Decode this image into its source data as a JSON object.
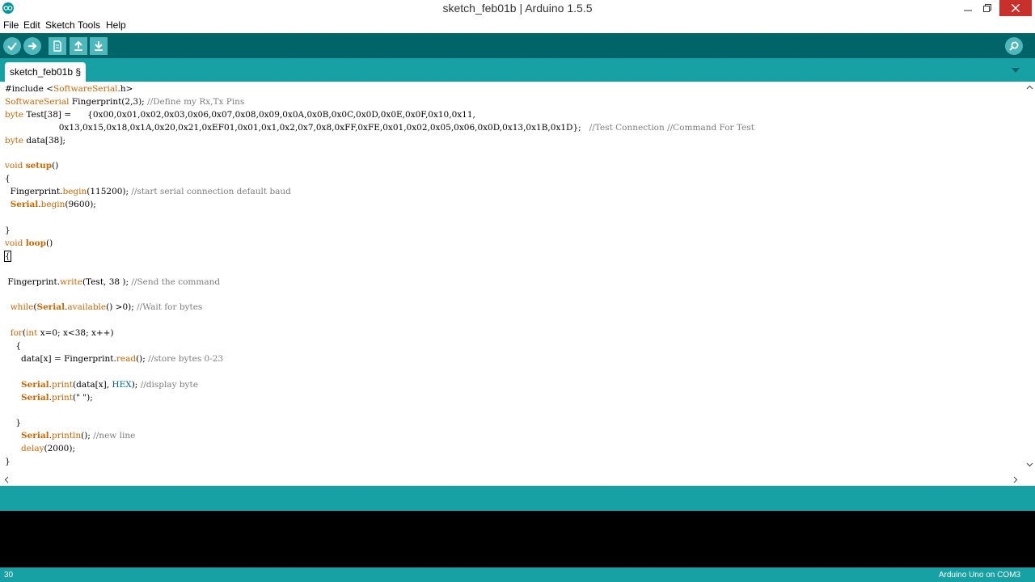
{
  "window": {
    "title": "sketch_feb01b | Arduino 1.5.5"
  },
  "menu": [
    "File",
    "Edit",
    "Sketch",
    "Tools",
    "Help"
  ],
  "toolbar": {
    "buttons": [
      "verify-icon",
      "upload-icon",
      "new-icon",
      "open-icon",
      "save-icon"
    ],
    "serial_monitor": "magnifier-icon"
  },
  "tab": {
    "label": "sketch_feb01b §"
  },
  "code": [
    [
      {
        "t": "#include <"
      },
      {
        "t": "SoftwareSerial",
        "c": "kw"
      },
      {
        "t": ".h>"
      }
    ],
    [
      {
        "t": "SoftwareSerial",
        "c": "kw"
      },
      {
        "t": " Fingerprint(2,3); "
      },
      {
        "t": "//Define my Rx,Tx Pins",
        "c": "cm"
      }
    ],
    [
      {
        "t": "byte",
        "c": "kw"
      },
      {
        "t": " Test[38] =      {0x00,0x01,0x02,0x03,0x06,0x07,0x08,0x09,0x0A,0x0B,0x0C,0x0D,0x0E,0x0F,0x10,0x11,"
      }
    ],
    [
      {
        "t": "                    0x13,0x15,0x18,0x1A,0x20,0x21,0xEF01,0x01,0x1,0x2,0x7,0x8,0xFF,0xFE,0x01,0x02,0x05,0x06,0x0D,0x13,0x1B,0x1D};   "
      },
      {
        "t": "//Test Connection //Command For Test",
        "c": "cm"
      }
    ],
    [
      {
        "t": "byte",
        "c": "kw"
      },
      {
        "t": " data[38];"
      }
    ],
    [],
    [
      {
        "t": "void",
        "c": "kw"
      },
      {
        "t": " "
      },
      {
        "t": "setup",
        "c": "kwb"
      },
      {
        "t": "()"
      }
    ],
    [
      {
        "t": "{"
      }
    ],
    [
      {
        "t": "  Fingerprint."
      },
      {
        "t": "begin",
        "c": "kw"
      },
      {
        "t": "(115200); "
      },
      {
        "t": "//start serial connection default baud",
        "c": "cm"
      }
    ],
    [
      {
        "t": "  "
      },
      {
        "t": "Serial",
        "c": "kwb"
      },
      {
        "t": "."
      },
      {
        "t": "begin",
        "c": "kw"
      },
      {
        "t": "(9600);"
      }
    ],
    [],
    [
      {
        "t": "}"
      }
    ],
    [
      {
        "t": "void",
        "c": "kw"
      },
      {
        "t": " "
      },
      {
        "t": "loop",
        "c": "kwb"
      },
      {
        "t": "()"
      }
    ],
    [
      {
        "t": "{",
        "c": "caret"
      }
    ],
    [],
    [
      {
        "t": " Fingerprint."
      },
      {
        "t": "write",
        "c": "kw"
      },
      {
        "t": "(Test, 38 ); "
      },
      {
        "t": "//Send the command",
        "c": "cm"
      }
    ],
    [],
    [
      {
        "t": "  "
      },
      {
        "t": "while",
        "c": "kw"
      },
      {
        "t": "("
      },
      {
        "t": "Serial",
        "c": "kwb"
      },
      {
        "t": "."
      },
      {
        "t": "available",
        "c": "kw"
      },
      {
        "t": "() >0); "
      },
      {
        "t": "//Wait for bytes",
        "c": "cm"
      }
    ],
    [],
    [
      {
        "t": "  "
      },
      {
        "t": "for",
        "c": "kw"
      },
      {
        "t": "("
      },
      {
        "t": "int",
        "c": "kw"
      },
      {
        "t": " x=0; x<38; x++)"
      }
    ],
    [
      {
        "t": "    {"
      }
    ],
    [
      {
        "t": "      data[x] = Fingerprint."
      },
      {
        "t": "read",
        "c": "kw"
      },
      {
        "t": "(); "
      },
      {
        "t": "//store bytes 0-23",
        "c": "cm"
      }
    ],
    [],
    [
      {
        "t": "      "
      },
      {
        "t": "Serial",
        "c": "kwb"
      },
      {
        "t": "."
      },
      {
        "t": "print",
        "c": "kw"
      },
      {
        "t": "(data[x], "
      },
      {
        "t": "HEX",
        "c": "cn"
      },
      {
        "t": "); "
      },
      {
        "t": "//display byte",
        "c": "cm"
      }
    ],
    [
      {
        "t": "      "
      },
      {
        "t": "Serial",
        "c": "kwb"
      },
      {
        "t": "."
      },
      {
        "t": "print",
        "c": "kw"
      },
      {
        "t": "(\" \");"
      }
    ],
    [],
    [
      {
        "t": "    }"
      }
    ],
    [
      {
        "t": "      "
      },
      {
        "t": "Serial",
        "c": "kwb"
      },
      {
        "t": "."
      },
      {
        "t": "println",
        "c": "kw"
      },
      {
        "t": "(); "
      },
      {
        "t": "//new line",
        "c": "cm"
      }
    ],
    [
      {
        "t": "      "
      },
      {
        "t": "delay",
        "c": "kw"
      },
      {
        "t": "(2000);"
      }
    ],
    [
      {
        "t": "}"
      }
    ]
  ],
  "status": {
    "message": ""
  },
  "footer": {
    "line": "30",
    "board": "Arduino Uno on COM3"
  },
  "colors": {
    "toolbar": "#006468",
    "accent": "#17a1a5",
    "button": "#4db7bb",
    "keyword": "#cc6600",
    "comment": "#7e7e7e",
    "constant": "#006699"
  }
}
